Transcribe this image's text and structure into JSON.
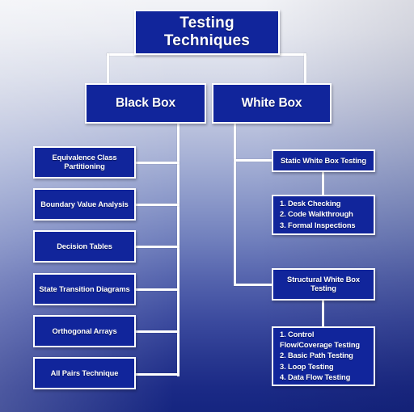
{
  "diagram": {
    "title_box": {
      "label": "Testing Techniques"
    },
    "level2": [
      {
        "key": "black-box",
        "label": "Black Box"
      },
      {
        "key": "white-box",
        "label": "White Box"
      }
    ],
    "black_box_children": [
      {
        "key": "equivalence-class-partitioning",
        "label": "Equivalence Class Partitioning"
      },
      {
        "key": "boundary-value-analysis",
        "label": "Boundary Value Analysis"
      },
      {
        "key": "decision-tables",
        "label": "Decision Tables"
      },
      {
        "key": "state-transition-diagrams",
        "label": "State Transition Diagrams"
      },
      {
        "key": "orthogonal-arrays",
        "label": "Orthogonal Arrays"
      },
      {
        "key": "all-pairs-technique",
        "label": "All Pairs Technique"
      }
    ],
    "white_box_children": [
      {
        "key": "static-white-box-testing",
        "label": "Static White Box Testing",
        "items": [
          "1. Desk Checking",
          "2. Code Walkthrough",
          "3. Formal Inspections"
        ]
      },
      {
        "key": "structural-white-box-testing",
        "label": "Structural White Box Testing",
        "items": [
          "1. Control Flow/Coverage Testing",
          "2. Basic Path Testing",
          "3. Loop Testing",
          "4. Data Flow Testing"
        ]
      }
    ],
    "colors": {
      "box_fill": "#11259b",
      "box_border": "#ffffff",
      "connector": "#ffffff",
      "text": "#ffffff",
      "background_top": "#f2f3f7",
      "background_bottom": "#152580"
    }
  }
}
